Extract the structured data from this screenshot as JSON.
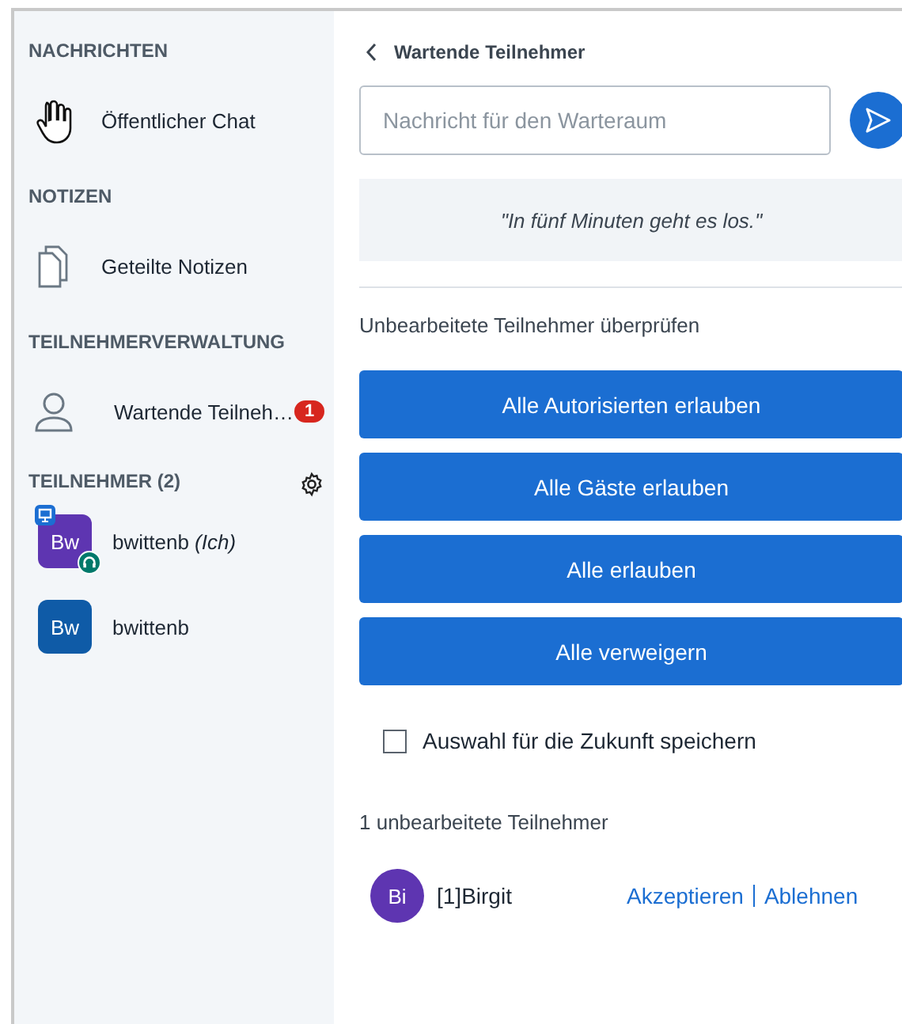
{
  "sidebar": {
    "sections": [
      {
        "title": "NACHRICHTEN",
        "items": [
          {
            "kind": "chat",
            "label": "Öffentlicher Chat",
            "hovered": true
          }
        ]
      },
      {
        "title": "NOTIZEN",
        "items": [
          {
            "kind": "notes",
            "label": "Geteilte Notizen",
            "hovered": false
          }
        ]
      },
      {
        "title": "TEILNEHMERVERWALTUNG",
        "items": [
          {
            "kind": "waiting",
            "label": "Wartende Teilneh…",
            "badge": "1",
            "hovered": false
          }
        ]
      }
    ],
    "users": {
      "title": "TEILNEHMER (2)",
      "list": [
        {
          "initials": "Bw",
          "name": "bwittenb",
          "suffix": "(Ich)",
          "color": "#5e35b1",
          "presenter": true,
          "audio": true
        },
        {
          "initials": "Bw",
          "name": "bwittenb",
          "color": "#0f5ba7",
          "presenter": false,
          "audio": false
        }
      ]
    }
  },
  "panel": {
    "title": "Wartende Teilnehmer",
    "message": {
      "placeholder": "Nachricht für den Warteraum"
    },
    "quote": "\"In fünf Minuten geht es los.\"",
    "review_label": "Unbearbeitete Teilnehmer überprüfen",
    "buttons": [
      "Alle Autorisierten erlauben",
      "Alle Gäste erlauben",
      "Alle erlauben",
      "Alle verweigern"
    ],
    "remember": {
      "label": "Auswahl für die Zukunft speichern",
      "checked": false
    },
    "count": "1 unbearbeitete Teilnehmer",
    "pending": [
      {
        "initials": "Bi",
        "name": "[1]Birgit",
        "color": "#5e35b1",
        "accept": "Akzeptieren",
        "reject": "Ablehnen"
      }
    ]
  }
}
